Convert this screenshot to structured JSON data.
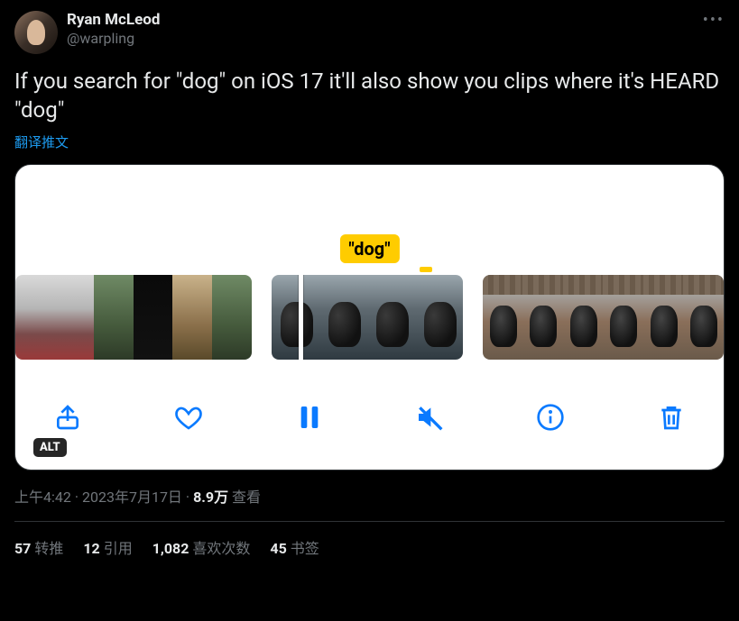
{
  "user": {
    "display_name": "Ryan McLeod",
    "handle": "@warpling"
  },
  "tweet_text": "If you search for \"dog\" on iOS 17 it'll also show you clips where it's HEARD \"dog\"",
  "translate_label": "翻译推文",
  "media": {
    "search_term": "\"dog\"",
    "alt_badge": "ALT",
    "toolbar": {
      "share": "share",
      "like": "like",
      "pause": "pause",
      "mute": "mute",
      "info": "info",
      "delete": "delete"
    }
  },
  "meta": {
    "time": "上午4:42",
    "date": "2023年7月17日",
    "views_count": "8.9万",
    "views_label": "查看"
  },
  "stats": {
    "retweet_count": "57",
    "retweet_label": "转推",
    "quote_count": "12",
    "quote_label": "引用",
    "like_count": "1,082",
    "like_label": "喜欢次数",
    "bookmark_count": "45",
    "bookmark_label": "书签"
  }
}
